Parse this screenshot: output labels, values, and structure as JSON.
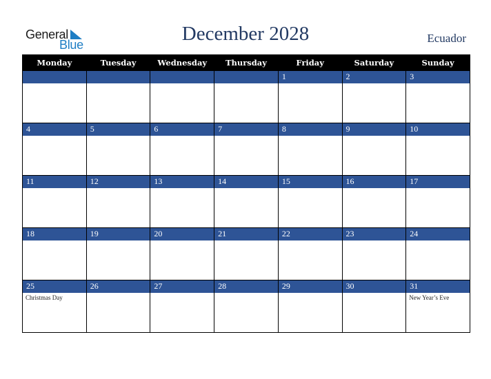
{
  "logo": {
    "line1": "General",
    "line2": "Blue",
    "icon": "triangle-flag-icon"
  },
  "header": {
    "title": "December 2028",
    "country": "Ecuador"
  },
  "colors": {
    "header_bg": "#000000",
    "day_band": "#2e5496",
    "title": "#233a63",
    "logo_blue": "#1f7ec4"
  },
  "weekdays": [
    "Monday",
    "Tuesday",
    "Wednesday",
    "Thursday",
    "Friday",
    "Saturday",
    "Sunday"
  ],
  "weeks": [
    [
      {
        "day": "",
        "event": ""
      },
      {
        "day": "",
        "event": ""
      },
      {
        "day": "",
        "event": ""
      },
      {
        "day": "",
        "event": ""
      },
      {
        "day": "1",
        "event": ""
      },
      {
        "day": "2",
        "event": ""
      },
      {
        "day": "3",
        "event": ""
      }
    ],
    [
      {
        "day": "4",
        "event": ""
      },
      {
        "day": "5",
        "event": ""
      },
      {
        "day": "6",
        "event": ""
      },
      {
        "day": "7",
        "event": ""
      },
      {
        "day": "8",
        "event": ""
      },
      {
        "day": "9",
        "event": ""
      },
      {
        "day": "10",
        "event": ""
      }
    ],
    [
      {
        "day": "11",
        "event": ""
      },
      {
        "day": "12",
        "event": ""
      },
      {
        "day": "13",
        "event": ""
      },
      {
        "day": "14",
        "event": ""
      },
      {
        "day": "15",
        "event": ""
      },
      {
        "day": "16",
        "event": ""
      },
      {
        "day": "17",
        "event": ""
      }
    ],
    [
      {
        "day": "18",
        "event": ""
      },
      {
        "day": "19",
        "event": ""
      },
      {
        "day": "20",
        "event": ""
      },
      {
        "day": "21",
        "event": ""
      },
      {
        "day": "22",
        "event": ""
      },
      {
        "day": "23",
        "event": ""
      },
      {
        "day": "24",
        "event": ""
      }
    ],
    [
      {
        "day": "25",
        "event": "Christmas Day"
      },
      {
        "day": "26",
        "event": ""
      },
      {
        "day": "27",
        "event": ""
      },
      {
        "day": "28",
        "event": ""
      },
      {
        "day": "29",
        "event": ""
      },
      {
        "day": "30",
        "event": ""
      },
      {
        "day": "31",
        "event": "New Year’s Eve"
      }
    ]
  ]
}
